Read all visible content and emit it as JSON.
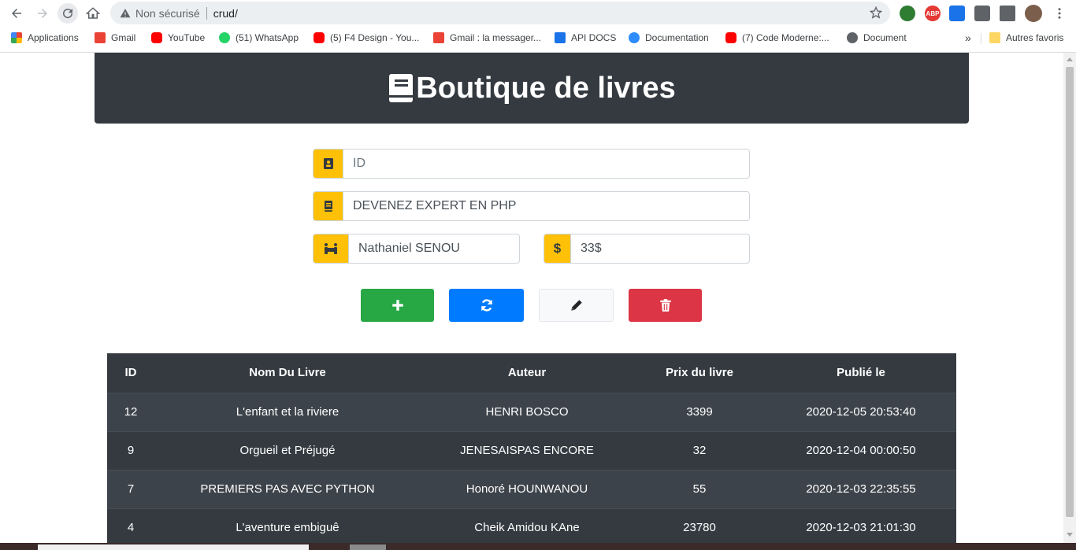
{
  "browser": {
    "security_label": "Non sécurisé",
    "url": "crud/",
    "extensions": [
      "globe-extension",
      "ABP",
      "tab-extension",
      "extensions-puzzle",
      "reading-list",
      "profile-avatar"
    ],
    "abp_label": "ABP",
    "bookmarks": [
      {
        "label": "Applications",
        "icon": "apps-grid-icon",
        "color": "#4285f4"
      },
      {
        "label": "Gmail",
        "icon": "gmail-icon",
        "color": "#ea4335"
      },
      {
        "label": "YouTube",
        "icon": "youtube-icon",
        "color": "#ff0000"
      },
      {
        "label": "(51) WhatsApp",
        "icon": "whatsapp-icon",
        "color": "#25d366"
      },
      {
        "label": "(5) F4 Design - You...",
        "icon": "youtube-icon",
        "color": "#ff0000"
      },
      {
        "label": "Gmail : la messager...",
        "icon": "gmail-icon",
        "color": "#ea4335"
      },
      {
        "label": "API DOCS",
        "icon": "graduation-cap-icon",
        "color": "#1a73e8"
      },
      {
        "label": "Documentation",
        "icon": "zoom-icon",
        "color": "#2d8cff"
      },
      {
        "label": "(7) Code Moderne:...",
        "icon": "youtube-icon",
        "color": "#ff0000"
      },
      {
        "label": "Document",
        "icon": "globe-icon",
        "color": "#5f6368"
      }
    ],
    "more_bookmarks": "»",
    "other_bookmarks": "Autres favoris"
  },
  "header": {
    "title": "Boutique de livres"
  },
  "form": {
    "id_placeholder": "ID",
    "id_value": "",
    "book_name_value": "DEVENEZ EXPERT EN PHP",
    "author_value": "Nathaniel SENOU",
    "price_value": "33$",
    "price_icon_glyph": "$"
  },
  "actions": {
    "add": "plus-icon",
    "refresh": "refresh-icon",
    "edit": "pencil-icon",
    "delete": "trash-icon"
  },
  "table": {
    "headers": [
      "ID",
      "Nom Du Livre",
      "Auteur",
      "Prix du livre",
      "Publié le"
    ],
    "rows": [
      {
        "id": "12",
        "name": "L'enfant et la riviere",
        "author": "HENRI BOSCO",
        "price": "3399",
        "date": "2020-12-05 20:53:40"
      },
      {
        "id": "9",
        "name": "Orgueil et Préjugé",
        "author": "JENESAISPAS ENCORE",
        "price": "32",
        "date": "2020-12-04 00:00:50"
      },
      {
        "id": "7",
        "name": "PREMIERS PAS AVEC PYTHON",
        "author": "Honoré HOUNWANOU",
        "price": "55",
        "date": "2020-12-03 22:35:55"
      },
      {
        "id": "4",
        "name": "L'aventure embiguê",
        "author": "Cheik Amidou KAne",
        "price": "23780",
        "date": "2020-12-03 21:01:30"
      }
    ]
  },
  "colors": {
    "header_bg": "#343a40",
    "addon": "#ffc107",
    "add": "#28a745",
    "refresh": "#007bff",
    "edit": "#f8f9fa",
    "delete": "#dc3545"
  }
}
